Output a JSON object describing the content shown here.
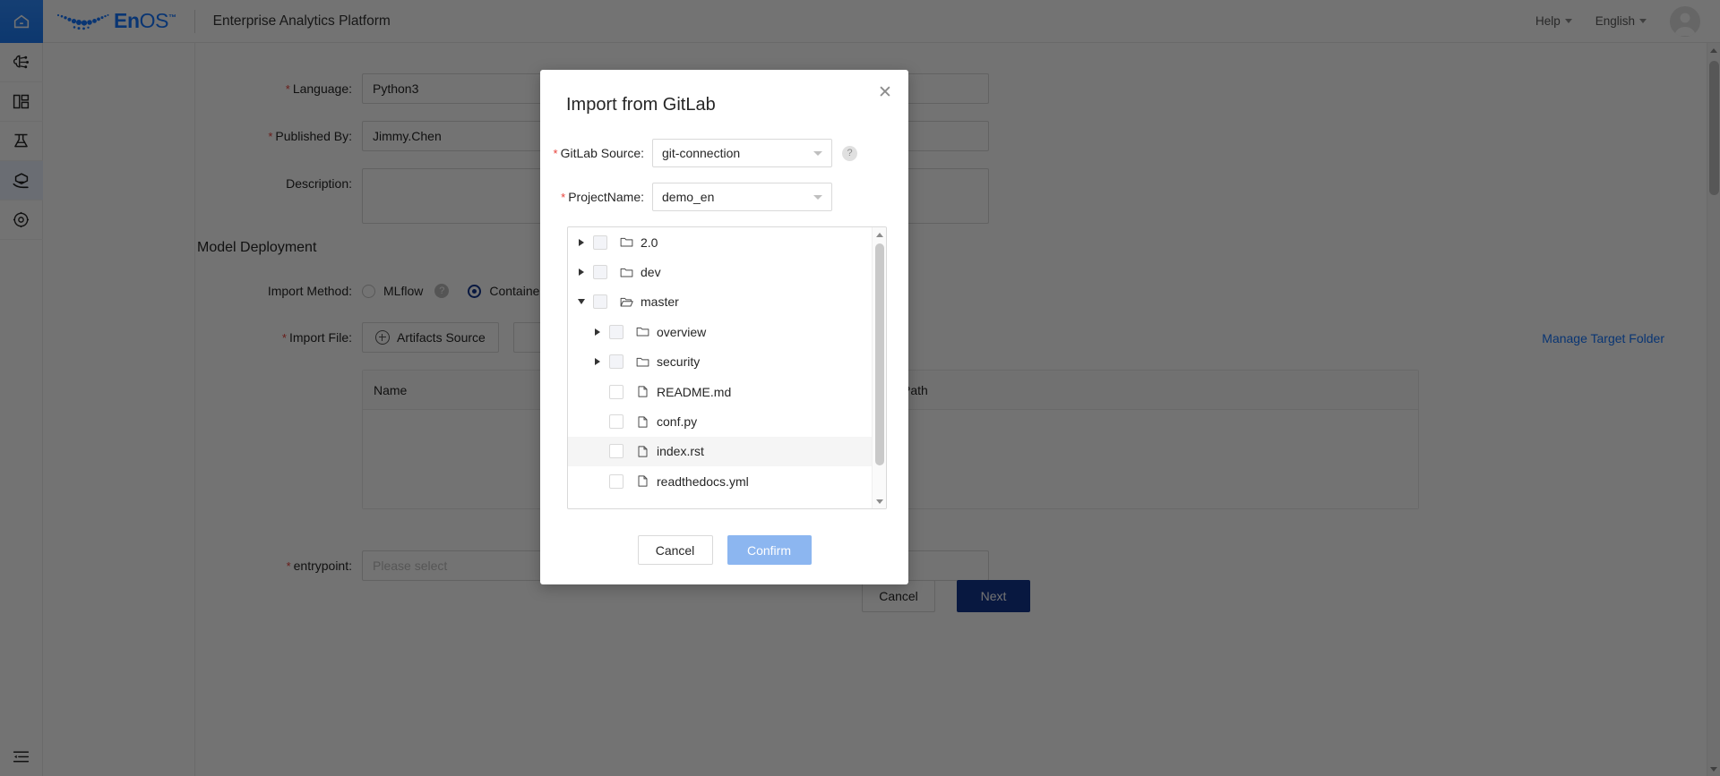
{
  "header": {
    "home_icon": "home-icon",
    "brand_en": "En",
    "brand_os": "OS",
    "brand_tm": "™",
    "app_title": "Enterprise Analytics Platform",
    "help_label": "Help",
    "language_label": "English"
  },
  "sidebar": {
    "items": [
      {
        "icon": "ai-model-icon",
        "active": false
      },
      {
        "icon": "dashboard-layout-icon",
        "active": false
      },
      {
        "icon": "lab-flask-icon",
        "active": false
      },
      {
        "icon": "model-serving-icon",
        "active": true
      },
      {
        "icon": "settings-gear-icon",
        "active": false
      }
    ],
    "collapse_icon": "collapse-menu-icon"
  },
  "form": {
    "fields": [
      {
        "label": "Language:",
        "required": true,
        "value": "Python3",
        "placeholder": ""
      },
      {
        "label": "Published By:",
        "required": true,
        "value": "Jimmy.Chen",
        "placeholder": ""
      },
      {
        "label": "Description:",
        "required": false,
        "value": "",
        "placeholder": ""
      }
    ],
    "section_title": "Model Deployment",
    "import_method": {
      "label": "Import Method:",
      "required": false,
      "options": [
        {
          "label": "MLflow",
          "selected": false,
          "help": "?"
        },
        {
          "label": "Container",
          "selected": true,
          "help": "?"
        }
      ]
    },
    "import_file": {
      "label": "Import File:",
      "required": true,
      "artifacts_button": "Artifacts Source",
      "second_button": ""
    },
    "manage_target_folder": "Manage Target Folder",
    "table": {
      "columns": [
        "Name",
        "Path"
      ]
    },
    "entrypoint": {
      "label": "entrypoint:",
      "required": true,
      "placeholder": "Please select"
    },
    "actions": {
      "cancel": "Cancel",
      "next": "Next"
    }
  },
  "modal": {
    "title": "Import from GitLab",
    "close_icon": "close-icon",
    "gitlab_source": {
      "label": "GitLab Source:",
      "required": true,
      "value": "git-connection",
      "help": "?"
    },
    "project_name": {
      "label": "ProjectName:",
      "required": true,
      "value": "demo_en"
    },
    "tree": [
      {
        "label": "2.0",
        "type": "folder",
        "depth": 0,
        "expandable": true,
        "expanded": false,
        "checked": false,
        "hover": false
      },
      {
        "label": "dev",
        "type": "folder",
        "depth": 0,
        "expandable": true,
        "expanded": false,
        "checked": false,
        "hover": false
      },
      {
        "label": "master",
        "type": "folder-open",
        "depth": 0,
        "expandable": true,
        "expanded": true,
        "checked": false,
        "hover": false
      },
      {
        "label": "overview",
        "type": "folder",
        "depth": 1,
        "expandable": true,
        "expanded": false,
        "checked": false,
        "hover": false
      },
      {
        "label": "security",
        "type": "folder",
        "depth": 1,
        "expandable": true,
        "expanded": false,
        "checked": false,
        "hover": false
      },
      {
        "label": "README.md",
        "type": "file",
        "depth": 1,
        "expandable": false,
        "expanded": false,
        "checked": false,
        "hover": false
      },
      {
        "label": "conf.py",
        "type": "file",
        "depth": 1,
        "expandable": false,
        "expanded": false,
        "checked": false,
        "hover": false
      },
      {
        "label": "index.rst",
        "type": "file",
        "depth": 1,
        "expandable": false,
        "expanded": false,
        "checked": false,
        "hover": true
      },
      {
        "label": "readthedocs.yml",
        "type": "file",
        "depth": 1,
        "expandable": false,
        "expanded": false,
        "checked": false,
        "hover": false
      }
    ],
    "buttons": {
      "cancel": "Cancel",
      "confirm": "Confirm"
    }
  },
  "colors": {
    "brand_blue": "#1677ff",
    "primary_dark": "#13368f",
    "confirm_disabled": "#8cb6f0",
    "required_star": "#e8413a",
    "link": "#1677ff"
  }
}
